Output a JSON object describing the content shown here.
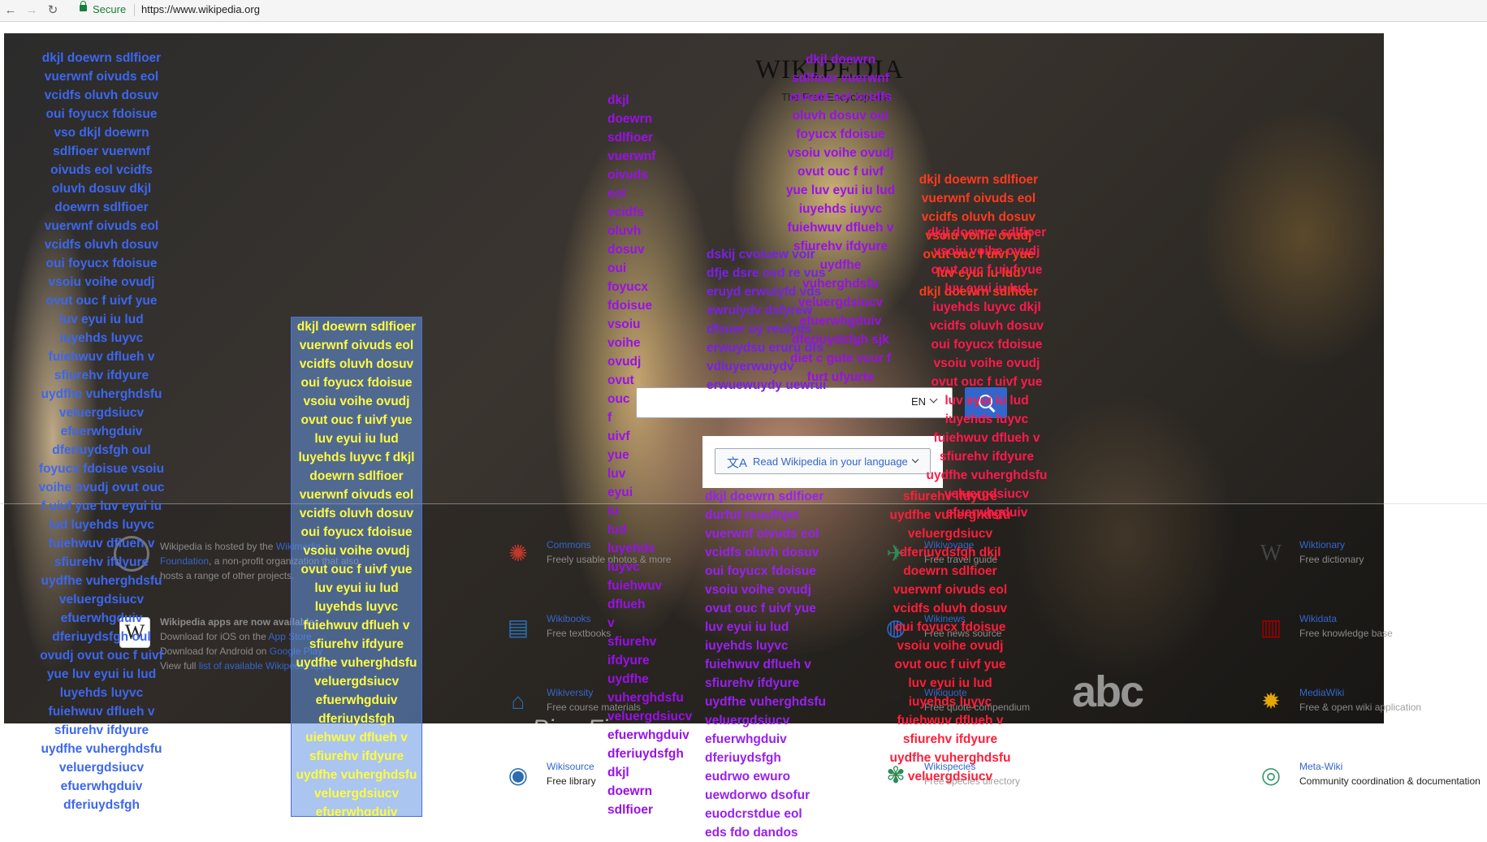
{
  "browser": {
    "secure_label": "Secure",
    "url": "https://www.wikipedia.org",
    "back_glyph": "←",
    "forward_glyph": "→",
    "reload_glyph": "↻"
  },
  "wiki": {
    "title": "WIKIPEDIA",
    "tagline": "The Free Encyclopedia"
  },
  "search": {
    "language": "EN",
    "read_in_language": "Read Wikipedia in your language",
    "translate_icon": "文A"
  },
  "footer": {
    "hosted_pre": "Wikipedia is hosted by the ",
    "hosted_link": "Wikimedia",
    "foundation_link": "Foundation",
    "hosted_post": ", a non-profit organization that also",
    "hosted_line3": "hosts a range of other projects.",
    "apps_heading": "Wikipedia apps are now available:",
    "ios_pre": "Download for iOS on the ",
    "ios_link": "App Store",
    "android_pre": "Download for Android on ",
    "android_link": "Google Play",
    "view_pre": "View full ",
    "view_link": "list of available Wikipedia apps",
    "app_icon": "W"
  },
  "projects": [
    {
      "name": "Commons",
      "desc": "Freely usable photos & more",
      "icon": "commons-icon",
      "glyph": "✺",
      "color": "#c0382b"
    },
    {
      "name": "Wikivoyage",
      "desc": "Free travel guide",
      "icon": "wikivoyage-icon",
      "glyph": "✈",
      "color": "#2e8b57"
    },
    {
      "name": "Wiktionary",
      "desc": "Free dictionary",
      "icon": "wiktionary-icon",
      "glyph": "W",
      "color": "#444"
    },
    {
      "name": "Wikibooks",
      "desc": "Free textbooks",
      "icon": "wikibooks-icon",
      "glyph": "▤",
      "color": "#2b6cb0"
    },
    {
      "name": "Wikinews",
      "desc": "Free news source",
      "icon": "wikinews-icon",
      "glyph": "◍",
      "color": "#3366cc"
    },
    {
      "name": "Wikidata",
      "desc": "Free knowledge base",
      "icon": "wikidata-icon",
      "glyph": "▥",
      "color": "#990000"
    },
    {
      "name": "Wikiversity",
      "desc": "Free course materials",
      "icon": "wikiversity-icon",
      "glyph": "⌂",
      "color": "#2b6cb0"
    },
    {
      "name": "Wikiquote",
      "desc": "Free quote compendium",
      "icon": "wikiquote-icon",
      "glyph": "❝",
      "color": "#222"
    },
    {
      "name": "MediaWiki",
      "desc": "Free & open wiki application",
      "icon": "mediawiki-icon",
      "glyph": "✹",
      "color": "#e6a800"
    },
    {
      "name": "Wikisource",
      "desc": "Free library",
      "icon": "wikisource-icon",
      "glyph": "◉",
      "color": "#2b6cb0"
    },
    {
      "name": "Wikispecies",
      "desc": "Free species directory",
      "icon": "wikispecies-icon",
      "glyph": "✾",
      "color": "#2e8b57"
    },
    {
      "name": "Meta-Wiki",
      "desc": "Community coordination & documentation",
      "icon": "metawiki-icon",
      "glyph": "◎",
      "color": "#339966"
    }
  ],
  "overlay": {
    "col_a": [
      "dkjl doewrn sdlfioer",
      "vuerwnf oivuds eol",
      "vcidfs oluvh dosuv",
      "oui foyucx fdoisue",
      "vso dkjl doewrn",
      "sdlfioer vuerwnf",
      "oivuds eol vcidfs",
      "oluvh dosuv dkjl",
      "doewrn sdlfioer",
      "vuerwnf oivuds eol",
      "vcidfs oluvh dosuv",
      "oui foyucx fdoisue",
      "vsoiu voihe ovudj",
      "ovut ouc f uivf yue",
      "luv eyui iu lud",
      "iuyehds luyvc",
      "fuiehwuv dflueh v",
      "sfiurehv ifdyure",
      "uydfhe vuherghdsfu",
      "veluergdsiucv",
      "efuerwhgduiv",
      "dferiuydsfgh oul",
      "foyucx fdoisue vsoiu",
      "voihe ovudj ovut ouc",
      "f uivf yue luv eyui iu",
      "lud luyehds luyvc",
      "fuiehwuv dflueh v",
      "sfiurehv ifdyure",
      "uydfhe vuherghdsfu",
      "veluergdsiucv",
      "efuerwhgduiv",
      "dferiuydsfgh oul",
      "ovudj ovut ouc f uivf",
      "yue luv eyui iu lud",
      "luyehds luyvc",
      "fuiehwuv dflueh v",
      "sfiurehv ifdyure",
      "uydfhe vuherghdsfu",
      "veluergdsiucv",
      "efuerwhgduiv",
      "dferiuydsfgh"
    ],
    "col_b": [
      "dkjl doewrn sdlfioer",
      "vuerwnf oivuds eol",
      "vcidfs oluvh dosuv",
      "oui foyucx fdoisue",
      "vsoiu voihe ovudj",
      "ovut ouc f uivf yue",
      "luv eyui iu lud",
      "luyehds luyvc f dkjl",
      "doewrn sdlfioer",
      "vuerwnf oivuds eol",
      "vcidfs oluvh dosuv",
      "oui foyucx fdoisue",
      "vsoiu voihe ovudj",
      "ovut ouc f uivf yue",
      "luv eyui iu lud",
      "luyehds luyvc",
      "fuiehwuv dflueh v",
      "sfiurehv ifdyure",
      "uydfhe vuherghdsfu",
      "veluergdsiucv",
      "efuerwhgduiv",
      "dferiuydsfgh",
      "uiehwuv dflueh v",
      "sfiurehv ifdyure",
      "uydfhe vuherghdsfu",
      "veluergdsiucv",
      "efuerwhgduiv"
    ],
    "col_c": [
      "dkjl",
      "doewrn",
      "sdlfioer",
      "vuerwnf",
      "oivuds",
      "eol",
      "vcidfs",
      "oluvh",
      "dosuv",
      "oui",
      "foyucx",
      "fdoisue",
      "vsoiu",
      "voihe",
      "ovudj",
      "ovut",
      "ouc",
      "f",
      "uivf",
      "yue",
      "luv",
      "eyui",
      "iu",
      "lud",
      "luyehds",
      "luyvc",
      "fuiehwuv",
      "dflueh",
      "v",
      "sfiurehv",
      "ifdyure",
      "uydfhe",
      "vuherghdsfu",
      "veluergdsiucv",
      "efuerwhgduiv",
      "dferiuydsfgh",
      "dkjl",
      "doewrn",
      "sdlfioer"
    ],
    "col_d": [
      "dkjl doewrn",
      "sdlfioer vuerwnf",
      "oivuds eol vcidfs",
      "oluvh dosuv oui",
      "foyucx fdoisue",
      "vsoiu voihe ovudj",
      "ovut ouc f uivf",
      "yue luv eyui iu lud",
      "iuyehds iuyvc",
      "fuiehwuv dflueh v",
      "sfiurehv ifdyure",
      "uydfhe",
      "vuherghdsfu",
      "veluergdsiucv",
      "efuerwhgduiv",
      "dferiuydsfgh sjk",
      "diet c gute vcur f",
      "furt ufyurte"
    ],
    "col_e": [
      "dskij cvoiuew voir",
      "dfje dsre ovd re vus",
      "eruyd erwuiyfd vds",
      "ewruiydv dsfyrew",
      "dfsuer uy reuiyds",
      "erwuydsu eruru dfs",
      "vdiuyerwuiydv",
      "erwuewuydy uewrui"
    ],
    "col_f": [
      "dkjl doewrn sdlfioer",
      "durfut rsuufhjet",
      "vuerwnf oivuds eol",
      "vcidfs oluvh dosuv",
      "oui foyucx fdoisue",
      "vsoiu voihe ovudj",
      "ovut ouc f uivf yue",
      "luv eyui iu lud",
      "iuyehds luyvc",
      "fuiehwuv dflueh v",
      "sfiurehv ifdyure",
      "uydfhe vuherghdsfu",
      "veluergdsiucv",
      "efuerwhgduiv",
      "dferiuydsfgh",
      "eudrwo ewuro",
      "uewdorwo dsofur",
      "euodcrstdue eol",
      "eds fdo dandos"
    ],
    "col_g": [
      "dkjl doewrn sdlfioer",
      "vuerwnf oivuds eol",
      "vcidfs oluvh dosuv",
      "vsoiu voihe ovudj",
      "ovut ouc f uivf yue",
      "luv eyui iu lud",
      "dkjl doewrn sdlfioer"
    ],
    "col_h": [
      "dkjl doewrn sdlfioer",
      "vsoiu voihe ovudj",
      "ovut ouc f uivf yue",
      "luv eyui iu lud",
      "iuyehds luyvc dkjl",
      "vcidfs oluvh dosuv",
      "oui foyucx fdoisue",
      "vsoiu voihe ovudj",
      "ovut ouc f uivf yue",
      "luv eyui iu lud",
      "iuyehds luyvc",
      "fuiehwuv dflueh v",
      "sfiurehv ifdyure",
      "uydfhe vuherghdsfu",
      "veluergdsiucv",
      "efuerwhgduiv"
    ],
    "col_i": [
      "sfiurehv ifdyure",
      "uydfhe vuherghdsfu",
      "veluergdsiucv",
      "dferiuydsfgh dkjl",
      "doewrn sdlfioer",
      "vuerwnf oivuds eol",
      "vcidfs oluvh dosuv",
      "oui foyucx fdoisue",
      "vsoiu voihe ovudj",
      "ovut ouc f uivf yue",
      "luv eyui iu lud",
      "iuyehds luyvc",
      "fuiehwuv dflueh v",
      "sfiurehv ifdyure",
      "uydfhe vuherghdsfu",
      "veluergdsiucv"
    ]
  },
  "video": {
    "watermark": "abc",
    "caption": "Pina Fine ev"
  }
}
